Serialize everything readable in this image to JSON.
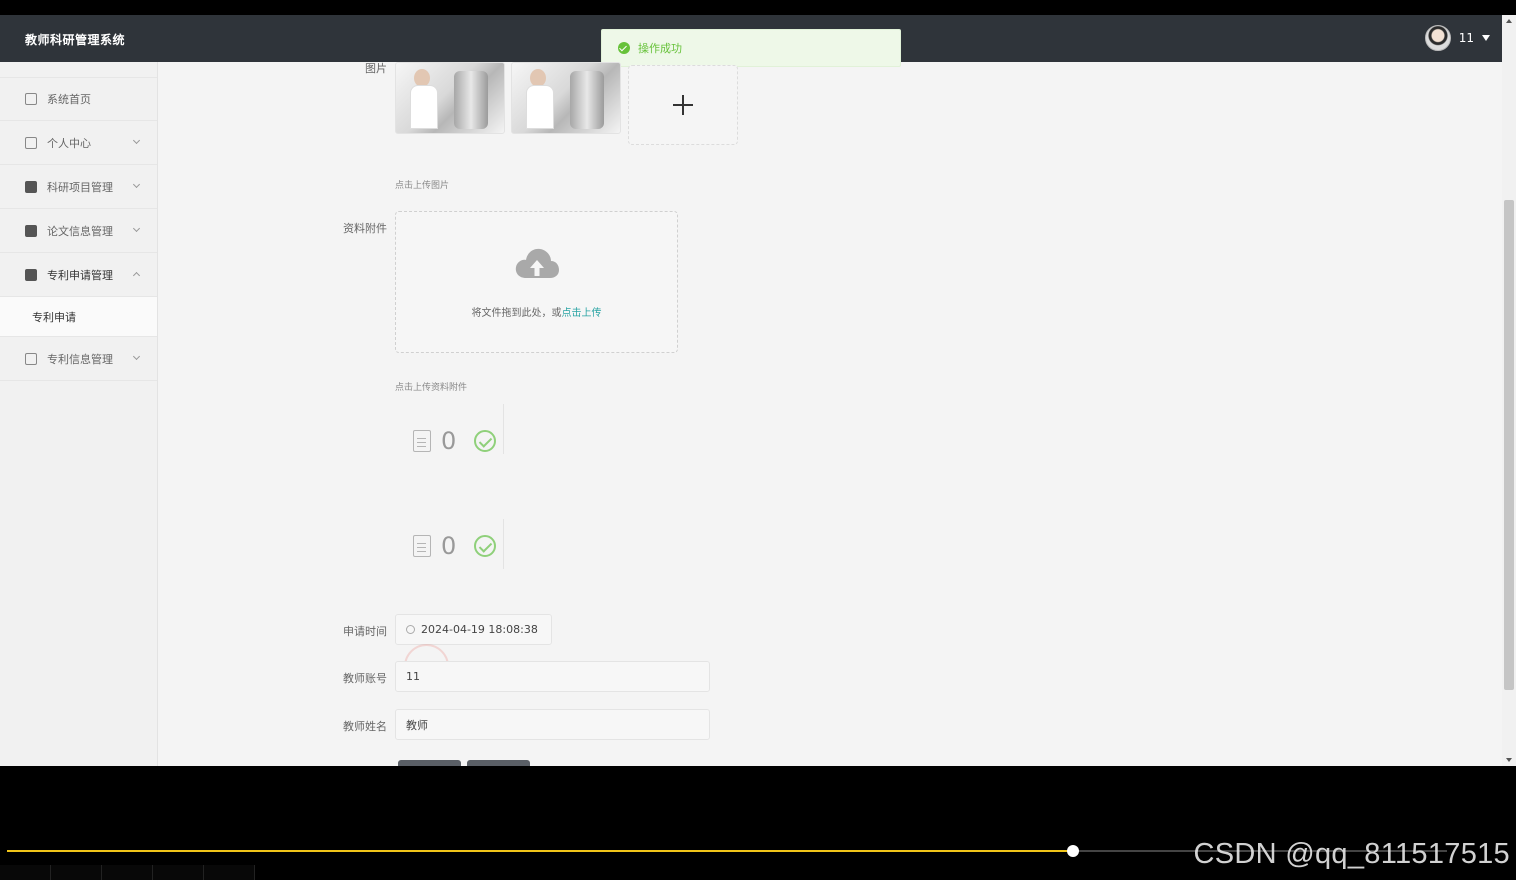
{
  "header": {
    "app_title": "教师科研管理系统",
    "username": "11"
  },
  "toast": {
    "message": "操作成功",
    "type": "success"
  },
  "sidebar": {
    "items": [
      {
        "label": "系统首页",
        "icon": "home-icon"
      },
      {
        "label": "个人中心",
        "icon": "card-icon"
      },
      {
        "label": "科研项目管理",
        "icon": "clipboard-icon"
      },
      {
        "label": "论文信息管理",
        "icon": "grid-icon"
      },
      {
        "label": "专利申请管理",
        "icon": "grid-icon",
        "expanded": true
      },
      {
        "label": "专利信息管理",
        "icon": "list-icon"
      }
    ],
    "subitem": {
      "label": "专利申请"
    }
  },
  "form": {
    "image_label": "图片",
    "image_hint": "点击上传图片",
    "attachment_label": "资料附件",
    "upload_text": "将文件拖到此处，或",
    "upload_link": "点击上传",
    "attachment_hint": "点击上传资料附件",
    "files": [
      {
        "count": "0",
        "status": "success"
      },
      {
        "count": "0",
        "status": "success"
      }
    ],
    "apply_time_label": "申请时间",
    "apply_time_value": "2024-04-19 18:08:38",
    "teacher_account_label": "教师账号",
    "teacher_account_value": "11",
    "teacher_name_label": "教师姓名",
    "teacher_name_value": "教师"
  },
  "player": {
    "progress": 0.74
  },
  "watermark": "CSDN @qq_811517515",
  "colors": {
    "topbar": "#2f343a",
    "success": "#67c23a",
    "link": "#2aa4a4",
    "progress": "#f0c419"
  }
}
